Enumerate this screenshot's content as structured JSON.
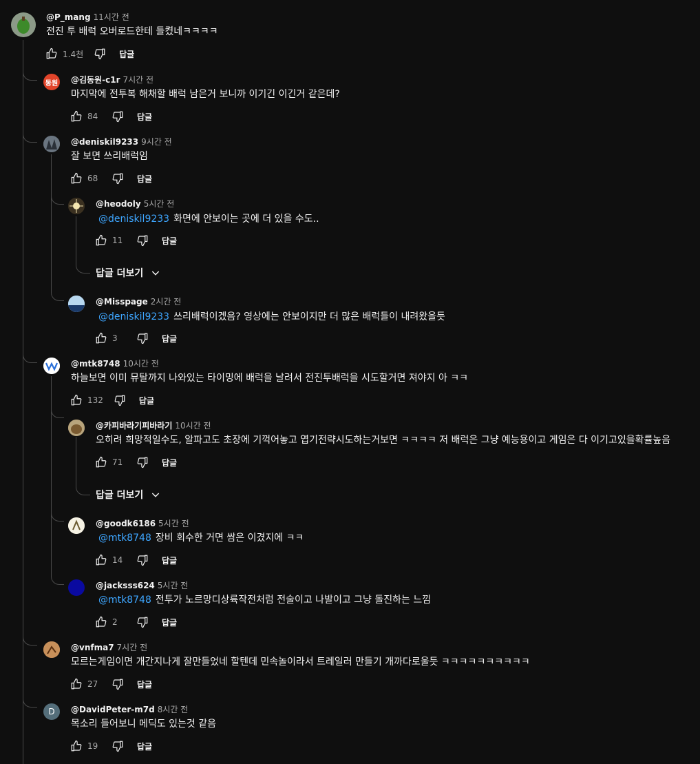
{
  "root": {
    "author": "@P_mang",
    "time": "11시간 전",
    "text": "전진 투 배럭 오버로드한테 들켰네ㅋㅋㅋㅋ",
    "likes": "1.4천",
    "reply_label": "답글"
  },
  "replies": [
    {
      "author": "@김동원-c1r",
      "time": "7시간 전",
      "text": "마지막에 전투복 해채할 배럭 남은거 보니까 이기긴 이긴거 같은데?",
      "likes": "84",
      "reply_label": "답글",
      "avatar_text": "동원"
    },
    {
      "author": "@deniskil9233",
      "time": "9시간 전",
      "text": "잘 보면 쓰리배럭임",
      "likes": "68",
      "reply_label": "답글"
    },
    {
      "author": "@heodoly",
      "time": "5시간 전",
      "mention": "@deniskil9233",
      "text": "화면에 안보이는 곳에 더 있을 수도..",
      "likes": "11",
      "reply_label": "답글"
    },
    {
      "author": "@Misspage",
      "time": "2시간 전",
      "mention": "@deniskil9233",
      "text": "쓰리배럭이겠음? 영상에는 안보이지만 더 많은 배럭들이 내려왔을듯",
      "likes": "3",
      "reply_label": "답글"
    },
    {
      "author": "@mtk8748",
      "time": "10시간 전",
      "text": "하늘보면 이미 뮤탈까지 나와있는 타이밍에 배럭을 날려서 전진투배럭을 시도할거면 져야지 아 ㅋㅋ",
      "likes": "132",
      "reply_label": "답글"
    },
    {
      "author": "@카피바라기피바라기",
      "time": "10시간 전",
      "text": "오히려 희망적일수도, 알파고도 초장에 기꺽어놓고 엽기전략시도하는거보면 ㅋㅋㅋㅋ 저 배럭은 그냥 예능용이고 게임은 다 이기고있을확률높음",
      "likes": "71",
      "reply_label": "답글"
    },
    {
      "author": "@goodk6186",
      "time": "5시간 전",
      "mention": "@mtk8748",
      "text": "장비 회수한 거면 쌈은 이겼지에 ㅋㅋ",
      "likes": "14",
      "reply_label": "답글"
    },
    {
      "author": "@jacksss624",
      "time": "5시간 전",
      "mention": "@mtk8748",
      "text": "전투가 노르망디상륙작전처럼 전술이고 나발이고 그냥 돌진하는 느낌",
      "likes": "2",
      "reply_label": "답글"
    },
    {
      "author": "@vnfma7",
      "time": "7시간 전",
      "text": "모르는게임이면 개간지나게 잘만들었네 할텐데 민속놀이라서 트레일러 만들기 개까다로울듯 ㅋㅋㅋㅋㅋㅋㅋㅋㅋㅋ",
      "likes": "27",
      "reply_label": "답글"
    },
    {
      "author": "@DavidPeter-m7d",
      "time": "8시간 전",
      "text": "목소리 들어보니 메딕도 있는것 같음",
      "likes": "19",
      "reply_label": "답글",
      "avatar_text": "D"
    }
  ],
  "more_replies_label": "답글 더보기",
  "colors": {
    "background": "#0f0f0f",
    "text": "#f1f1f1",
    "secondary": "#aaaaaa",
    "mention": "#3ea6ff",
    "thread_line": "#4a4a4a"
  }
}
